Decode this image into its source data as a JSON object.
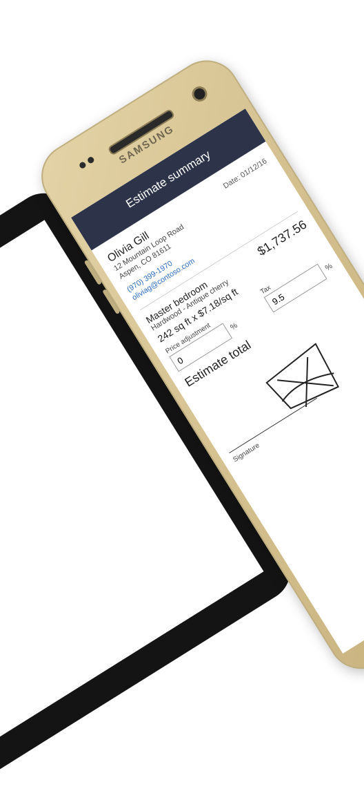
{
  "device": {
    "brand": "SAMSUNG"
  },
  "app": {
    "title": "Estimate summary",
    "date_label": "Date: 01/12/16",
    "customer": {
      "name": "Olivia Gill",
      "address_line1": "12 Mountain Loop Road",
      "address_line2": "Aspen, CO 81611",
      "phone": "(970) 399-1970",
      "email": "oliviag@contoso.com"
    },
    "item": {
      "title": "Master bedroom",
      "subtitle": "Hardwood - Antique cherry",
      "calculation": "242 sq ft x $7.18/sq ft",
      "price": "$1,737.56"
    },
    "price_adjustment": {
      "label": "Price adjustment",
      "value": "0",
      "unit": "%"
    },
    "tax": {
      "label": "Tax",
      "value": "9.5",
      "unit": "%"
    },
    "estimate_total_label": "Estimate total",
    "signature_label": "Signature"
  },
  "colors": {
    "appbar": "#2d3449",
    "link": "#2d6cc0",
    "phone_gold": "#d4c08f",
    "button": "#46a5d6"
  }
}
